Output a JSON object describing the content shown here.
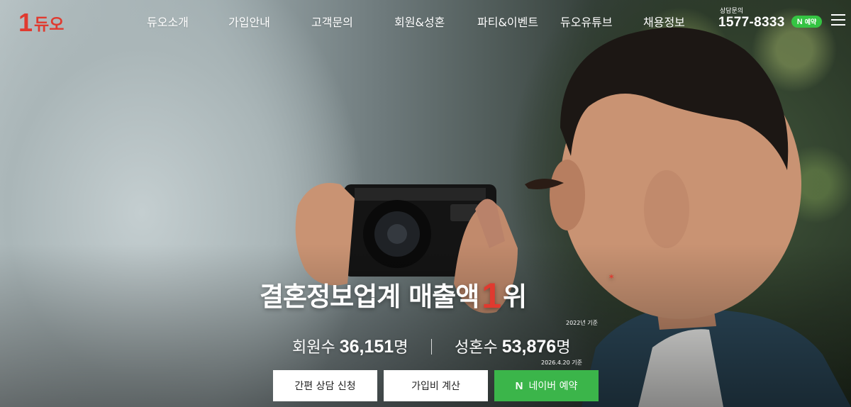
{
  "brand": {
    "logo_mark": "1",
    "logo_text": "듀오",
    "accent_color": "#e03a2f",
    "naver_green": "#3bb54a"
  },
  "nav": {
    "items": [
      {
        "label": "듀오소개"
      },
      {
        "label": "가입안내"
      },
      {
        "label": "고객문의"
      },
      {
        "label": "회원&성혼"
      },
      {
        "label": "파티&이벤트"
      },
      {
        "label": "듀오유튜브"
      },
      {
        "label": "채용정보"
      }
    ]
  },
  "contact": {
    "label": "상담문의",
    "phone": "1577-8333",
    "naver_badge_n": "N",
    "naver_badge_text": "예약"
  },
  "hero": {
    "headline_main": "결혼정보업계 매출액",
    "headline_rank_num": "1",
    "headline_rank_suffix": "위",
    "headline_mark": "*",
    "basis_year": "2022년 기준",
    "members_label": "회원수",
    "members_value": "36,151",
    "members_unit": "명",
    "marriages_label": "성혼수",
    "marriages_value": "53,876",
    "marriages_unit": "명",
    "basis_date": "2026.4.20 기준"
  },
  "cta": {
    "consult_label": "간편 상담 신청",
    "fee_label": "가입비 계산",
    "naver_n": "N",
    "naver_label": "네이버 예약"
  },
  "icons": {
    "menu": "hamburger-menu-icon",
    "naver": "naver-n-icon"
  }
}
